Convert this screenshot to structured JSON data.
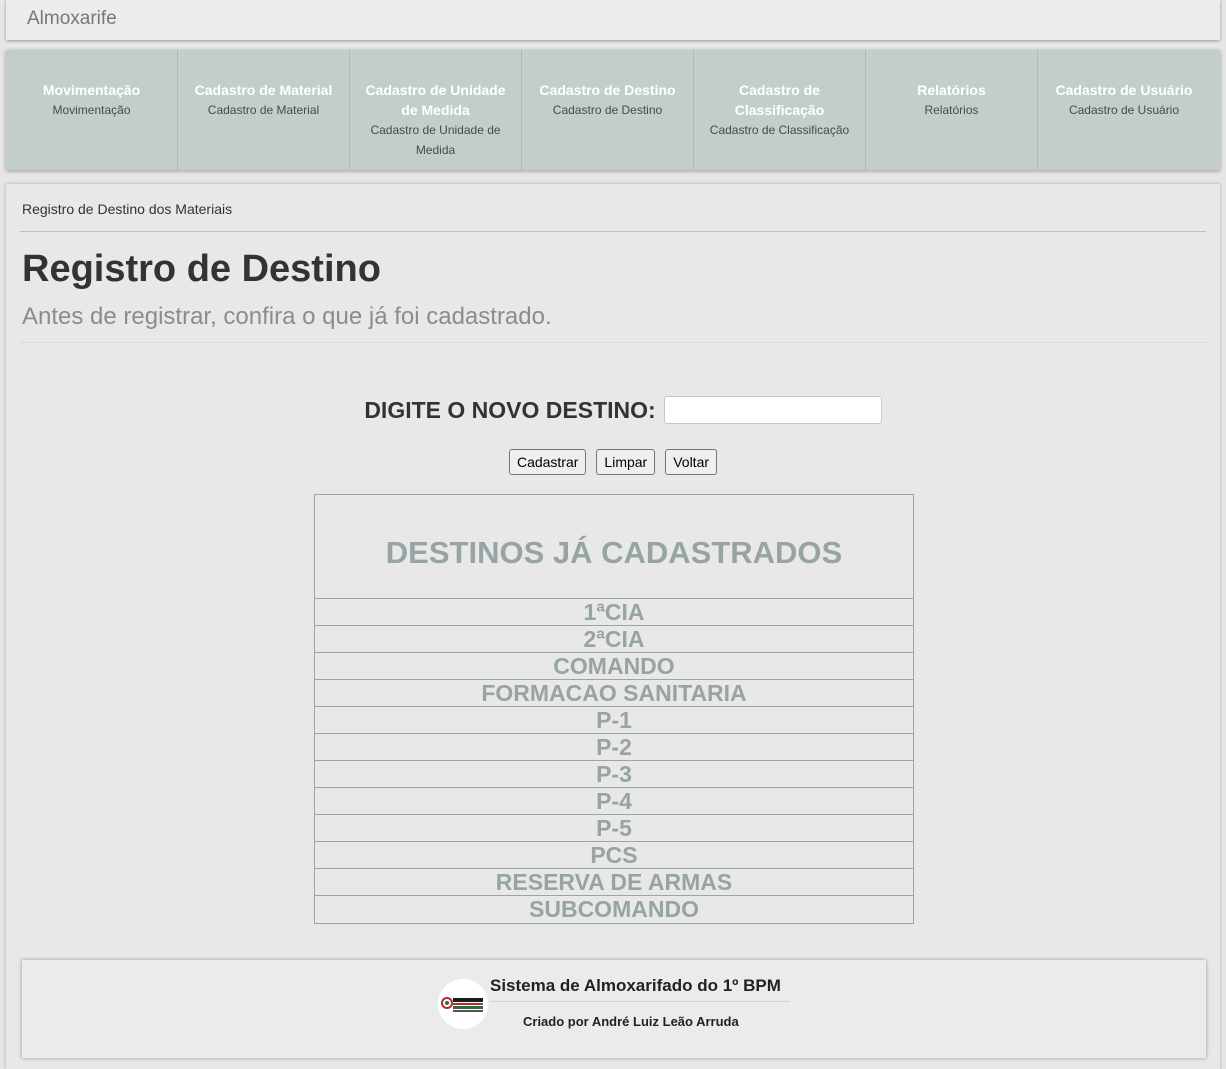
{
  "app": {
    "brand": "Almoxarife"
  },
  "nav": {
    "items": [
      {
        "title": "Movimentação",
        "subtitle": "Movimentação"
      },
      {
        "title": "Cadastro de Material",
        "subtitle": "Cadastro de Material"
      },
      {
        "title": "Cadastro de Unidade de Medida",
        "subtitle": "Cadastro de Unidade de Medida"
      },
      {
        "title": "Cadastro de Destino",
        "subtitle": "Cadastro de Destino"
      },
      {
        "title": "Cadastro de Classificação",
        "subtitle": "Cadastro de Classificação"
      },
      {
        "title": "Relatórios",
        "subtitle": "Relatórios"
      },
      {
        "title": "Cadastro de Usuário",
        "subtitle": "Cadastro de Usuário"
      }
    ]
  },
  "breadcrumb": "Registro de Destino dos Materiais",
  "page": {
    "title": "Registro de Destino",
    "subtitle": "Antes de registrar, confira o que já foi cadastrado."
  },
  "form": {
    "label": "DIGITE O NOVO DESTINO:",
    "input_value": "",
    "buttons": {
      "submit": "Cadastrar",
      "clear": "Limpar",
      "back": "Voltar"
    }
  },
  "destinations": {
    "header": "DESTINOS JÁ CADASTRADOS",
    "items": [
      "1ªCIA",
      "2ªCIA",
      "COMANDO",
      "FORMACAO SANITARIA",
      "P-1",
      "P-2",
      "P-3",
      "P-4",
      "P-5",
      "PCS",
      "RESERVA DE ARMAS",
      "SUBCOMANDO"
    ]
  },
  "footer": {
    "title": "Sistema de Almoxarifado do 1º BPM",
    "credit": "Criado por André Luiz Leão Arruda",
    "logo_icon": "battalion-logo-icon"
  },
  "colors": {
    "nav_background": "#c3cdcc",
    "table_text": "#96a4a3",
    "page_background": "#e6e6e6"
  }
}
